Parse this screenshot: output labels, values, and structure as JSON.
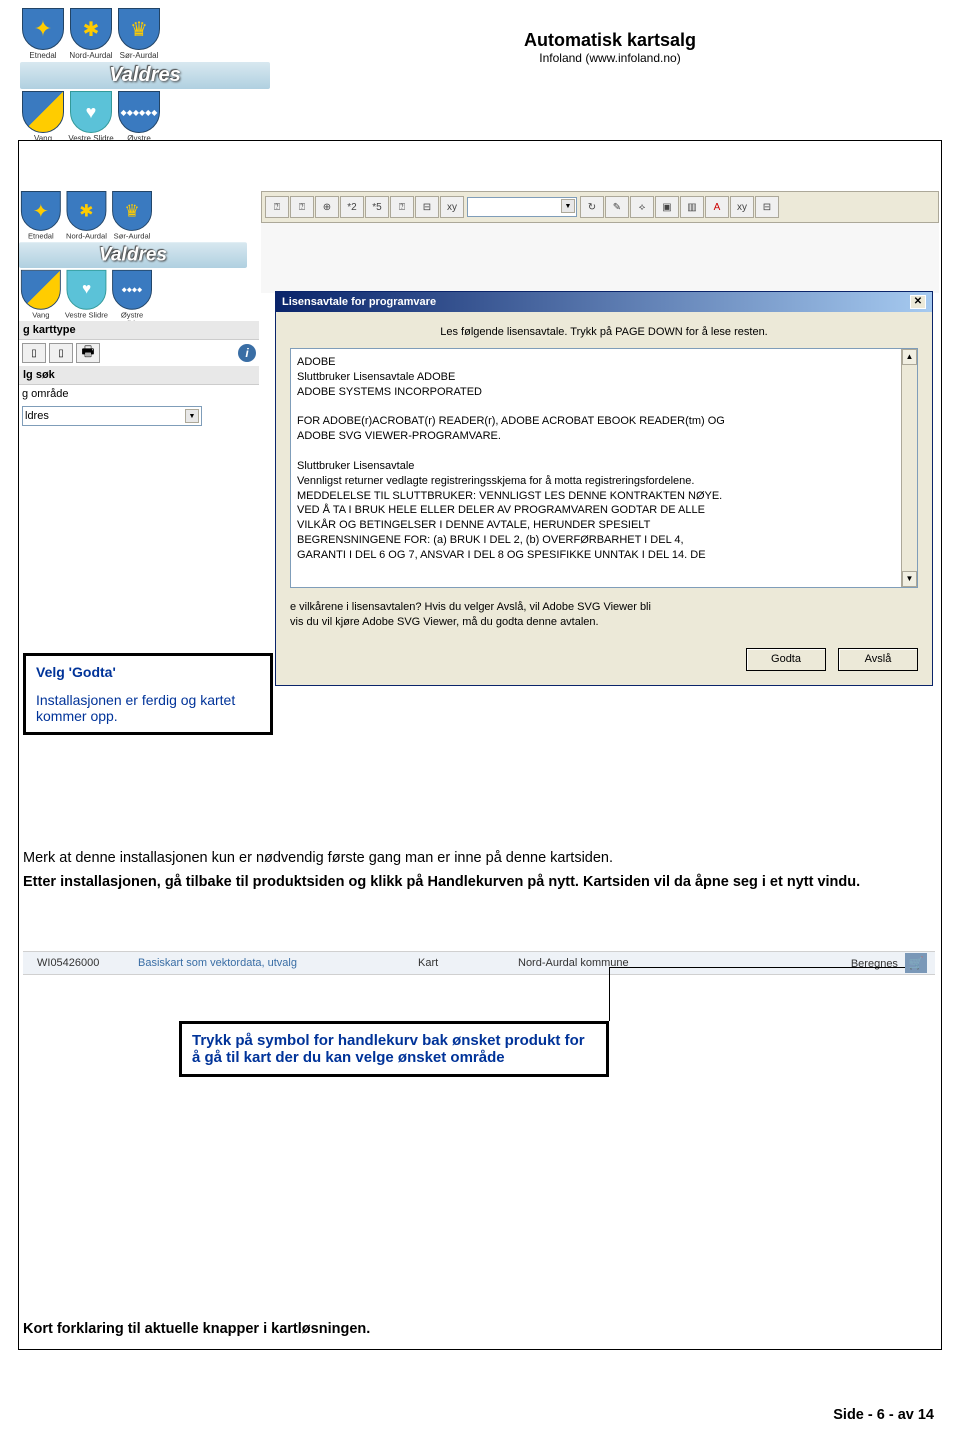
{
  "header": {
    "title": "Automatisk kartsalg",
    "subtitle": "Infoland (www.infoland.no)"
  },
  "shields": {
    "row1": [
      "Etnedal",
      "Nord-Aurdal",
      "Sør-Aurdal"
    ],
    "valdres": "Valdres",
    "row2": [
      "Vang",
      "Vestre Slidre",
      "Øystre Slidre"
    ]
  },
  "toolbar": {
    "btns": [
      "⍰",
      "⍰",
      "⊕",
      "*2",
      "*5",
      "⍰",
      "⊟",
      "xy"
    ],
    "btns2": [
      "↻",
      "✎",
      "⟡",
      "▣",
      "▥",
      "A",
      "xy",
      "⊟"
    ]
  },
  "leftpanel": {
    "kart_header": "g karttype",
    "sok_header": "lg søk",
    "omrade_label": "g område",
    "select_value": "ldres"
  },
  "dialog": {
    "title": "Lisensavtale for programvare",
    "instruction": "Les følgende lisensavtale. Trykk på PAGE DOWN for å lese resten.",
    "lines": [
      "ADOBE",
      "Sluttbruker Lisensavtale ADOBE",
      "ADOBE SYSTEMS INCORPORATED",
      "",
      "FOR ADOBE(r)ACROBAT(r) READER(r), ADOBE ACROBAT EBOOK READER(tm) OG",
      "ADOBE SVG VIEWER-PROGRAMVARE.",
      "",
      "Sluttbruker Lisensavtale",
      "Vennligst returner vedlagte registreringsskjema for å motta registreringsfordelene.",
      "MEDDELELSE TIL SLUTTBRUKER:  VENNLIGST LES DENNE KONTRAKTEN NØYE.",
      " VED Å TA I BRUK HELE  ELLER DELER AV PROGRAMVAREN GODTAR DE ALLE",
      "VILKÅR OG BETINGELSER I DENNE AVTALE, HERUNDER  SPESIELT",
      "BEGRENSNINGENE FOR: (a) BRUK I DEL 2, (b) OVERFØRBARHET I DEL 4,",
      "GARANTI I DEL 6 OG 7, ANSVAR I DEL 8 OG SPESIFIKKE UNNTAK I DEL 14. DE"
    ],
    "question": "e vilkårene i lisensavtalen? Hvis du velger Avslå, vil Adobe SVG Viewer bli\nvis du vil kjøre Adobe SVG Viewer, må du godta denne avtalen.",
    "btn_accept": "Godta",
    "btn_decline": "Avslå"
  },
  "callout1": {
    "heading": "Velg 'Godta'",
    "body": "Installasjonen er ferdig og kartet kommer opp."
  },
  "body": {
    "p1": "Merk at denne installasjonen kun er nødvendig første gang man er inne på denne kartsiden.",
    "p2": "Etter installasjonen, gå tilbake til produktsiden og klikk på Handlekurven på nytt. Kartsiden vil da åpne seg i et nytt vindu."
  },
  "product": {
    "code": "WI05426000",
    "name": "Basiskart som vektordata, utvalg",
    "type": "Kart",
    "area": "Nord-Aurdal kommune",
    "price": "Beregnes"
  },
  "callout2": {
    "body": "Trykk på symbol for handlekurv bak ønsket produkt for å gå til kart der du kan velge ønsket område"
  },
  "bottom": "Kort forklaring til aktuelle knapper i kartløsningen.",
  "footer": "Side - 6 - av 14"
}
